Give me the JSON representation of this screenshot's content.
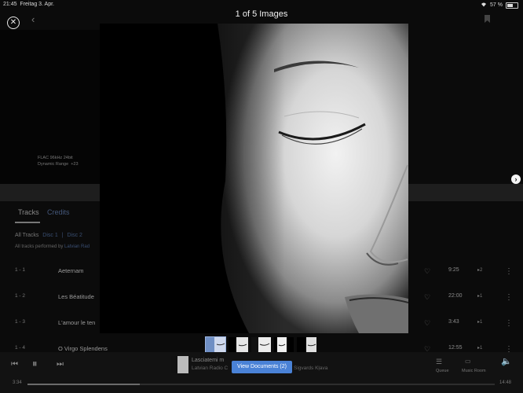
{
  "status_bar": {
    "time": "21:45",
    "date": "Freitag 3. Apr.",
    "battery": "57 %"
  },
  "viewer": {
    "title": "1 of 5 Images",
    "progress_fraction": 0.2
  },
  "album": {
    "format": "FLAC 96kHz 24bit",
    "dynamic_range": "Dynamic Range",
    "dr_value": "+23"
  },
  "tabs": [
    {
      "label": "Tracks"
    },
    {
      "label": "Credits"
    }
  ],
  "filters": {
    "all": "All Tracks",
    "disc1": "Disc 1",
    "sep": "|",
    "disc2": "Disc 2"
  },
  "performed": {
    "prefix": "All tracks performed by",
    "artist": "Latvian Rad"
  },
  "tracks": [
    {
      "num": "1 - 1",
      "title": "Aeternam",
      "duration": "9:25",
      "level": "▸2"
    },
    {
      "num": "1 - 2",
      "title": "Les Béatitude",
      "duration": "22:00",
      "level": "▸1"
    },
    {
      "num": "1 - 3",
      "title": "L'amour le ten",
      "duration": "3:43",
      "level": "▸1"
    },
    {
      "num": "1 - 4",
      "title": "O Virgo Splendens",
      "duration": "12:55",
      "level": "▸1"
    }
  ],
  "now_playing": {
    "title": "Lasciatemi m",
    "subtitle": "Latvian Radio C",
    "artist": "Sigvards Kļava"
  },
  "view_documents": "View Documents (2)",
  "player": {
    "queue_label": "Queue",
    "music_room_label": "Music Room",
    "elapsed": "3:34",
    "total": "14:48",
    "progress_fraction": 0.24
  },
  "icons": {
    "close": "close-icon",
    "back": "chevron-left-icon",
    "bookmark": "bookmark-icon",
    "next": "chevron-right-icon",
    "heart": "heart-icon",
    "more": "more-vertical-icon",
    "prev": "skip-previous-icon",
    "pause": "pause-icon",
    "skip": "skip-next-icon",
    "volume": "volume-icon",
    "queue": "queue-icon",
    "music_room": "speaker-icon"
  },
  "colors": {
    "accent": "#4a82d6",
    "link": "#3a4f73"
  }
}
